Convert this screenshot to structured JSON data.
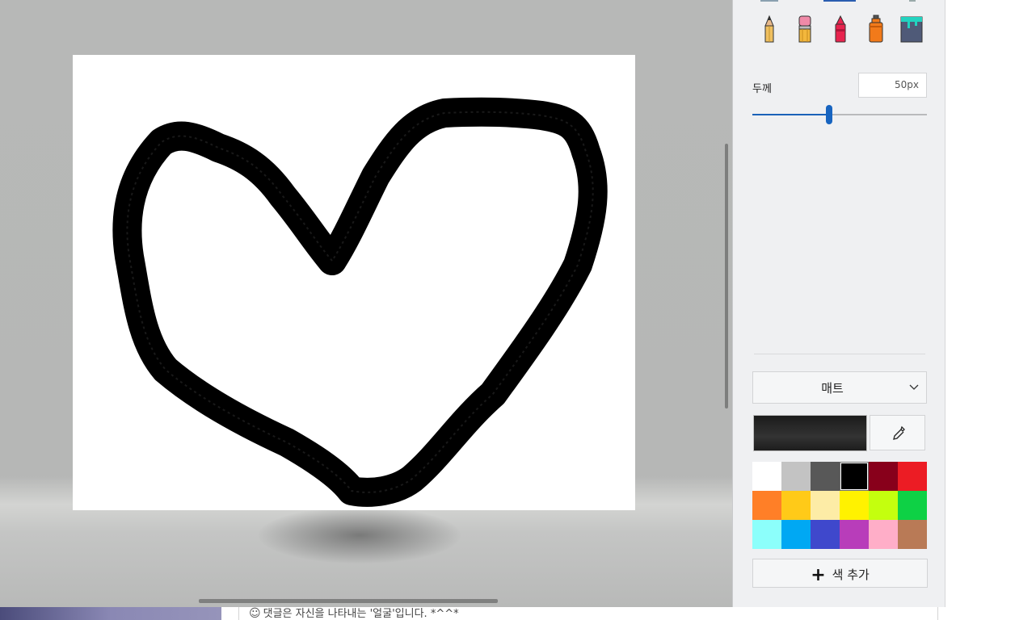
{
  "tools": [
    {
      "name": "pencil",
      "icon": "pencil-icon"
    },
    {
      "name": "eraser",
      "icon": "eraser-icon"
    },
    {
      "name": "crayon",
      "icon": "crayon-icon"
    },
    {
      "name": "spray-can",
      "icon": "spray-can-icon"
    },
    {
      "name": "fill",
      "icon": "paint-bucket-icon"
    }
  ],
  "thickness": {
    "label": "두께",
    "value_text": "50px",
    "slider_fraction": 0.44
  },
  "finish": {
    "label": "매트"
  },
  "current_color": "#1f1f1f",
  "palette": [
    "#ffffff",
    "#c3c3c3",
    "#585858",
    "#000000",
    "#88001b",
    "#ec1c24",
    "#ff7f27",
    "#ffca18",
    "#fdeca6",
    "#fff200",
    "#c4ff0e",
    "#0ed145",
    "#8cfffb",
    "#00a8f3",
    "#3f48cc",
    "#b83dba",
    "#ffaec8",
    "#b97a56"
  ],
  "selected_palette_index": 3,
  "add_color": {
    "label": "색 추가"
  },
  "comment": {
    "text": "댓글은 자신을 나타내는 '얼굴'입니다. *^^*"
  },
  "canvas": {
    "drawing": "heart-stroke",
    "stroke_color": "#000000"
  }
}
